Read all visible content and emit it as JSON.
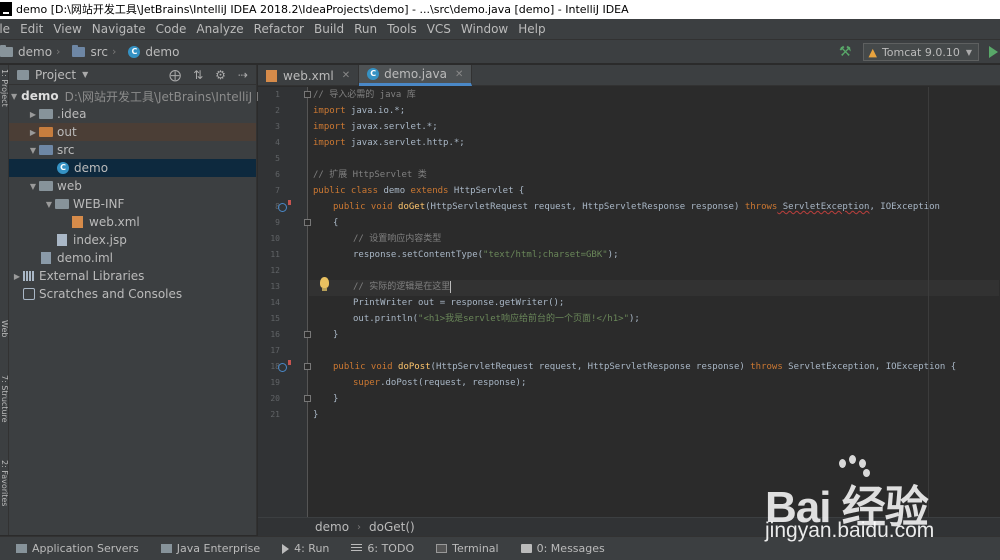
{
  "window": {
    "title": "demo [D:\\网站开发工具\\JetBrains\\IntelliJ IDEA 2018.2\\IdeaProjects\\demo] - ...\\src\\demo.java [demo] - IntelliJ IDEA"
  },
  "menu": [
    "ile",
    "Edit",
    "View",
    "Navigate",
    "Code",
    "Analyze",
    "Refactor",
    "Build",
    "Run",
    "Tools",
    "VCS",
    "Window",
    "Help"
  ],
  "navbar": {
    "crumbs": [
      "demo",
      "src",
      "demo"
    ],
    "run_config": "Tomcat 9.0.10"
  },
  "left_stripe": {
    "project": "1: Project",
    "web": "Web",
    "structure": "7: Structure",
    "favorites": "2: Favorites"
  },
  "project_panel": {
    "title": "Project",
    "tree": [
      {
        "label": "demo",
        "hint": "D:\\网站开发工具\\JetBrains\\IntelliJ IDE"
      },
      {
        "label": ".idea"
      },
      {
        "label": "out"
      },
      {
        "label": "src"
      },
      {
        "label": "demo"
      },
      {
        "label": "web"
      },
      {
        "label": "WEB-INF"
      },
      {
        "label": "web.xml"
      },
      {
        "label": "index.jsp"
      },
      {
        "label": "demo.iml"
      },
      {
        "label": "External Libraries"
      },
      {
        "label": "Scratches and Consoles"
      }
    ]
  },
  "tabs": [
    {
      "label": "web.xml"
    },
    {
      "label": "demo.java"
    }
  ],
  "editor": {
    "line_numbers": [
      "1",
      "2",
      "3",
      "4",
      "5",
      "6",
      "7",
      "8",
      "9",
      "10",
      "11",
      "12",
      "13",
      "14",
      "15",
      "16",
      "17",
      "18",
      "19",
      "20",
      "21"
    ],
    "lines": {
      "l1_comment": "// 导入必需的 java 库",
      "l2_kw": "import",
      "l2_rest": " java.io.*;",
      "l3_kw": "import",
      "l3_rest": " javax.servlet.*;",
      "l4_kw": "import",
      "l4_rest": " javax.servlet.http.*;",
      "l6_comment": "// 扩展 HttpServlet 类",
      "l7_kw": "public class",
      "l7_name": " demo ",
      "l7_kw2": "extends",
      "l7_rest": " HttpServlet {",
      "l8_kw": "public void",
      "l8_fn": " doGet",
      "l8_args": "(HttpServletRequest request, HttpServletResponse response) ",
      "l8_kw2": "throws",
      "l8_exc": " ServletException",
      "l8_rest": ", IOException",
      "l9": "{",
      "l10_comment": "// 设置响应内容类型",
      "l11_pre": "response.setContentType(",
      "l11_str": "\"text/html;charset=GBK\"",
      "l11_post": ");",
      "l13_comment": "// 实际的逻辑是在这里",
      "l14": "PrintWriter out = response.getWriter();",
      "l15_pre": "out.println(",
      "l15_str": "\"<h1>我是servlet响应给前台的一个页面!</h1>\"",
      "l15_post": ");",
      "l16": "}",
      "l18_kw": "public void",
      "l18_fn": " doPost",
      "l18_args": "(HttpServletRequest request, HttpServletResponse response) ",
      "l18_kw2": "throws",
      "l18_rest": " ServletException, IOException {",
      "l19_kw": "super",
      "l19_rest": ".doPost(request, response);",
      "l20": "}",
      "l21": "}"
    }
  },
  "code_breadcrumbs": [
    "demo",
    "doGet()"
  ],
  "bottom_tools": [
    {
      "label": "Application Servers"
    },
    {
      "label": "Java Enterprise"
    },
    {
      "label": "4: Run"
    },
    {
      "label": "6: TODO"
    },
    {
      "label": "Terminal"
    },
    {
      "label": "0: Messages"
    }
  ],
  "watermark": {
    "brand": "Bai  经验",
    "url": "jingyan.baidu.com"
  },
  "colors": {
    "keyword": "#cc7832",
    "comment": "#808080",
    "string": "#6a8759",
    "method": "#ffc66d",
    "accent": "#4a88c7"
  }
}
